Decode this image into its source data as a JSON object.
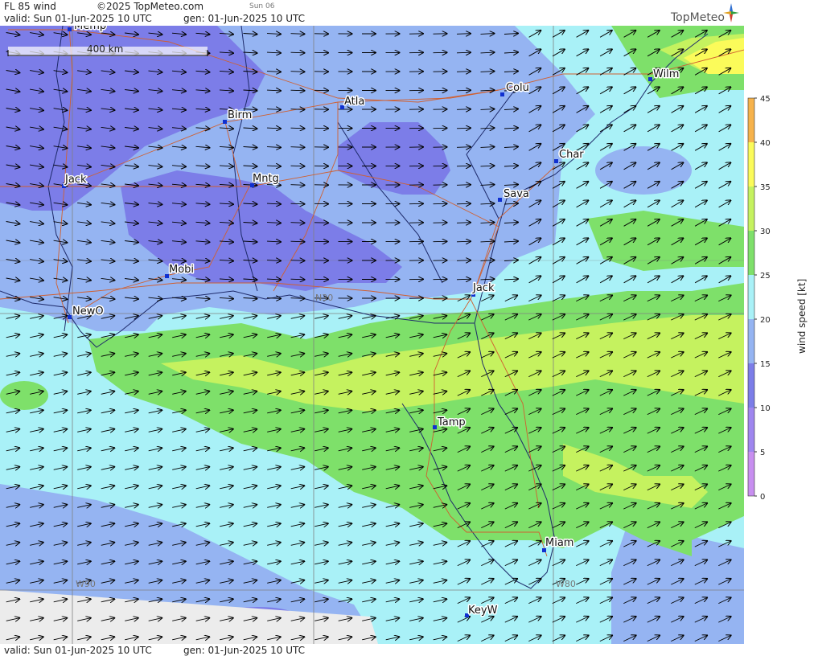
{
  "header": {
    "product": "FL 85 wind",
    "copyright": "©2025 TopMeteo.com",
    "day_short": "Sun 06",
    "valid_line": "valid:  Sun  01-Jun-2025  10 UTC",
    "gen_line": "gen: 01-Jun-2025 10 UTC",
    "logo_text": "TopMeteo"
  },
  "footer": {
    "valid_line": "valid:  Sun  01-Jun-2025  10 UTC",
    "gen_line": "gen: 01-Jun-2025 10 UTC"
  },
  "map": {
    "scale_label": "400 km",
    "grid_labels": [
      "N30",
      "W90",
      "W80"
    ],
    "cities": [
      {
        "name": "Memp"
      },
      {
        "name": "Birm"
      },
      {
        "name": "Atla"
      },
      {
        "name": "Colu"
      },
      {
        "name": "Wilm"
      },
      {
        "name": "Char"
      },
      {
        "name": "Sava"
      },
      {
        "name": "Jack"
      },
      {
        "name": "Mntg"
      },
      {
        "name": "Mobi"
      },
      {
        "name": "NewO"
      },
      {
        "name": "Jack"
      },
      {
        "name": "Tamp"
      },
      {
        "name": "Miam"
      },
      {
        "name": "KeyW"
      }
    ],
    "wind_arrows": "arrow-icon"
  },
  "legend": {
    "title": "wind speed [kt]",
    "ticks": [
      "0",
      "5",
      "10",
      "15",
      "20",
      "25",
      "30",
      "35",
      "40",
      "45"
    ],
    "colors": [
      "#c88ff0",
      "#9f86ef",
      "#7c7de8",
      "#95b4f2",
      "#a9f1f7",
      "#7ee06a",
      "#c5f25f",
      "#fbfb5a",
      "#f6b24b",
      "#ec6b4c"
    ]
  }
}
